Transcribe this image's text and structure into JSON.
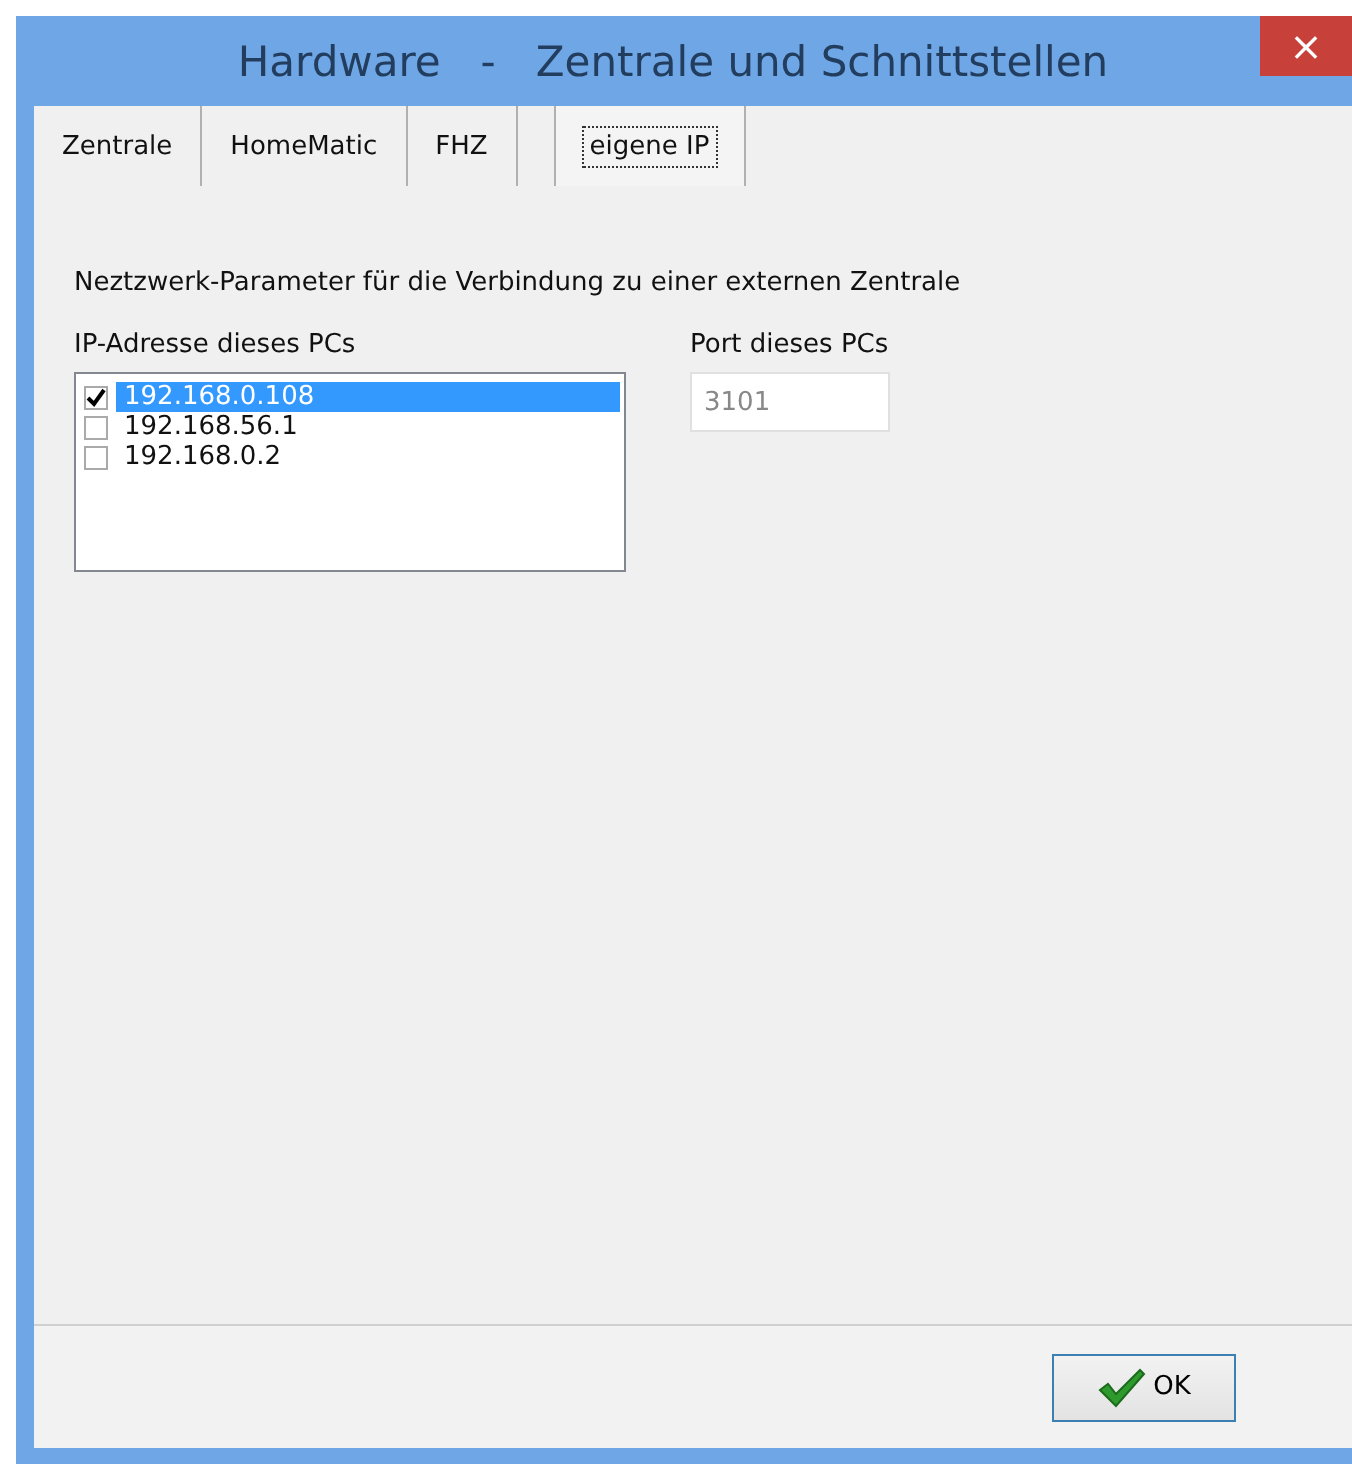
{
  "window": {
    "title": "Hardware   -   Zentrale und Schnittstellen",
    "close": "×"
  },
  "tabs": [
    {
      "label": "Zentrale",
      "selected": false
    },
    {
      "label": "HomeMatic",
      "selected": false
    },
    {
      "label": "FHZ",
      "selected": false
    },
    {
      "label": "eigene IP",
      "selected": true
    }
  ],
  "description": "Neztzwerk-Parameter für die Verbindung zu einer externen Zentrale",
  "ip_list": {
    "label": "IP-Adresse dieses PCs",
    "items": [
      {
        "address": "192.168.0.108",
        "checked": true,
        "selected": true
      },
      {
        "address": "192.168.56.1",
        "checked": false,
        "selected": false
      },
      {
        "address": "192.168.0.2",
        "checked": false,
        "selected": false
      }
    ]
  },
  "port": {
    "label": "Port dieses PCs",
    "value": "3101",
    "disabled": true
  },
  "buttons": [
    {
      "label": "OK"
    }
  ]
}
